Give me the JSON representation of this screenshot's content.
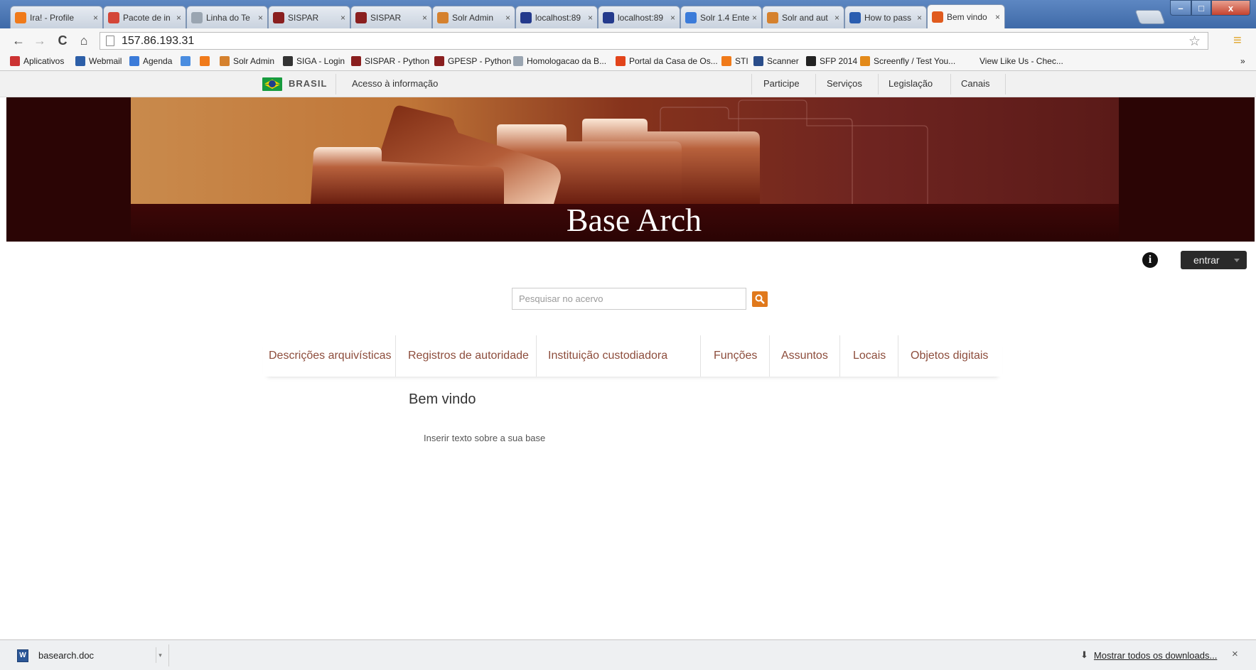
{
  "browser": {
    "tabs": [
      {
        "label": "Ira! - Profile",
        "icon": "orange-square-icon",
        "color": "#f07a1a"
      },
      {
        "label": "Pacote de in",
        "icon": "gmail-icon",
        "color": "#d44638"
      },
      {
        "label": "Linha do Te",
        "icon": "page-icon",
        "color": "#9aa5b1"
      },
      {
        "label": "SISPAR",
        "icon": "sispar-icon",
        "color": "#8a1f1f"
      },
      {
        "label": "SISPAR",
        "icon": "sispar-icon",
        "color": "#8a1f1f"
      },
      {
        "label": "Solr Admin",
        "icon": "solr-icon",
        "color": "#d5812e"
      },
      {
        "label": "localhost:89",
        "icon": "jira-icon",
        "color": "#243a8c"
      },
      {
        "label": "localhost:89",
        "icon": "jira-icon",
        "color": "#243a8c"
      },
      {
        "label": "Solr 1.4 Ente",
        "icon": "google-icon",
        "color": "#3b7bd9"
      },
      {
        "label": "Solr and aut",
        "icon": "solr-icon",
        "color": "#d5812e"
      },
      {
        "label": "How to pass",
        "icon": "moon-icon",
        "color": "#2a5db0"
      },
      {
        "label": "Bem vindo",
        "icon": "atom-icon",
        "color": "#e05b1e",
        "active": true
      }
    ],
    "tab_close": "×",
    "window_controls": {
      "minimize": "–",
      "maximize": "□",
      "close": "x"
    },
    "address": "157.86.193.31",
    "bookmarks": [
      {
        "label": "Aplicativos",
        "icon": "apps-grid-icon",
        "color": "#c33"
      },
      {
        "label": "Webmail",
        "icon": "webmail-icon",
        "color": "#2d5fa8"
      },
      {
        "label": "Agenda",
        "icon": "calendar-icon",
        "color": "#3b7bd9"
      },
      {
        "label": "",
        "icon": "translate-icon",
        "color": "#4a8de0"
      },
      {
        "label": "",
        "icon": "orange-square-icon",
        "color": "#f07a1a"
      },
      {
        "label": "Solr Admin",
        "icon": "solr-icon",
        "color": "#d5812e"
      },
      {
        "label": "SIGA - Login",
        "icon": "siga-icon",
        "color": "#333"
      },
      {
        "label": "SISPAR - Python",
        "icon": "sispar-icon",
        "color": "#8a1f1f"
      },
      {
        "label": "GPESP - Python",
        "icon": "sispar-icon",
        "color": "#8a1f1f"
      },
      {
        "label": "Homologacao da B...",
        "icon": "page-icon",
        "color": "#9aa5b1"
      },
      {
        "label": "Portal da Casa de Os...",
        "icon": "joomla-icon",
        "color": "#e2441b"
      },
      {
        "label": "STI",
        "icon": "orange-square-icon",
        "color": "#f07a1a"
      },
      {
        "label": "Scanner",
        "icon": "scanner-icon",
        "color": "#2a4d8a"
      },
      {
        "label": "SFP 2014",
        "icon": "b-icon",
        "color": "#222"
      },
      {
        "label": "Screenfly / Test You...",
        "icon": "screenfly-icon",
        "color": "#e38a1a"
      },
      {
        "label": "View Like Us - Chec...",
        "icon": "",
        "color": ""
      }
    ],
    "bookmarks_overflow": "»"
  },
  "gov_bar": {
    "country": "BRASIL",
    "access_info": "Acesso à informação",
    "links": [
      "Participe",
      "Serviços",
      "Legislação",
      "Canais"
    ]
  },
  "site": {
    "title": "Base Arch",
    "login_label": "entrar",
    "search_placeholder": "Pesquisar no acervo",
    "menu": [
      "Descrições arquivísticas",
      "Registros de autoridade",
      "Instituição custodiadora",
      "Funções",
      "Assuntos",
      "Locais",
      "Objetos digitais"
    ],
    "page_title": "Bem vindo",
    "page_body": "Inserir texto sobre a sua base"
  },
  "downloads": {
    "file": "basearch.doc",
    "show_all": "Mostrar todos os downloads...",
    "close": "×"
  },
  "colors": {
    "banner_dark": "#2b0505",
    "menu_link": "#8d4d3c",
    "search_button": "#e0791c",
    "login_button": "#2a2a2a"
  }
}
